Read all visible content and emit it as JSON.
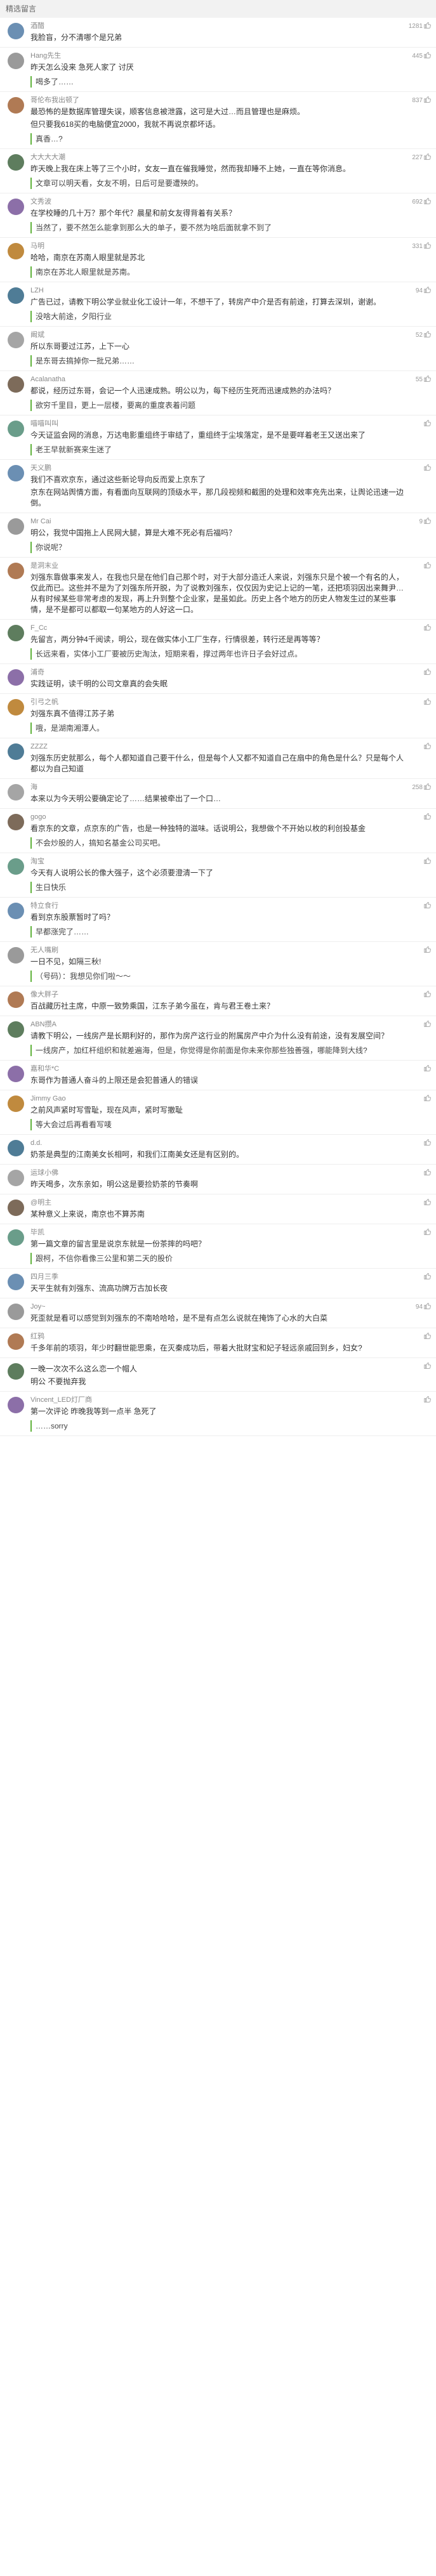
{
  "header": {
    "title": "精选留言"
  },
  "comments": [
    {
      "name": "酒醋",
      "date": "",
      "likes": "1281",
      "text": "我脸盲，分不清哪个是兄弟",
      "reply": ""
    },
    {
      "name": "Hang先生",
      "date": "",
      "likes": "445",
      "text": "昨天怎么没来 急死人家了 讨厌",
      "reply": "喝多了……"
    },
    {
      "name": "哥伦布我出顿了",
      "date": "",
      "likes": "837",
      "text": "最恐怖的是数据库管理失误，顺客信息被泄露，这可是大过…而且管理也是麻烦。",
      "text2": "但只要我618买的电脑便宜2000，我就不再说京都坏话。",
      "reply": "真香…?"
    },
    {
      "name": "大大大大潮",
      "date": "",
      "likes": "227",
      "text": "昨天晚上我在床上等了三个小时，女友一直在催我睡觉，然而我却睡不上她，一直在等你消息。",
      "reply": "文章可以明天看，女友不明，日后可是要遭殃的。"
    },
    {
      "name": "文秀波",
      "date": "",
      "likes": "692",
      "text": "在学校睡的几十万？那个年代？晨星和前女友得背着有关系？",
      "reply": "当然了，要不然怎么能拿到那么大的单子，要不然为啥后面就拿不到了"
    },
    {
      "name": "马明",
      "date": "",
      "likes": "331",
      "text": "哈哈，南京在苏南人眼里就是苏北",
      "reply": "南京在苏北人眼里就是苏南。"
    },
    {
      "name": "LZH",
      "date": "",
      "likes": "94",
      "text": "广告已过，请教下明公学业就业化工设计一年，不想干了，转房产中介是否有前途，打算去深圳，谢谢。",
      "reply": "没啥大前途，夕阳行业"
    },
    {
      "name": "阚斌",
      "date": "",
      "likes": "52",
      "text": "所以东哥要过江苏，上下一心",
      "reply": "是东哥去搞掉你一批兄弟……"
    },
    {
      "name": "Acalanatha",
      "date": "",
      "likes": "55",
      "text": "都说，经历过东哥，会记一个人迅速成熟。明公以为，每下经历生死而迅速成熟的办法吗？",
      "reply": "欲穷千里目，更上一层楼，要离的重度表着问题"
    },
    {
      "name": "喵喵叫叫",
      "date": "",
      "likes": "",
      "text": "今天证监会网的消息，万达电影重组终于审结了，重组终于尘埃落定，是不是要咩着老王又送出来了",
      "reply": "老王早就新赛来生迷了"
    },
    {
      "name": "天义鹏",
      "date": "",
      "likes": "",
      "text": "我们不喜欢京东，通过这些新论导向反而爱上京东了",
      "text2": "京东在网站舆情方面，有看面向互联网的顶级水平，那几段视频和截图的处理和效率充先出来，让舆论迅速一边倒。",
      "reply": ""
    },
    {
      "name": "Mr Cai",
      "date": "",
      "likes": "9",
      "text": "明公，我觉中国拖上人民网大腿，算是大难不死必有后福吗？",
      "reply": "你说呢？"
    },
    {
      "name": "是洞末业",
      "date": "",
      "likes": "",
      "text": "刘强东靠做事来发人，在我也只是在他们自己那个时，对于大部分造迁人来说，刘强东只是个被一个有名的人，仅此而已。这些并不是为了刘强东所开脱，为了说教刘强东，仅仅因为史记上记的一笔，还把项羽因出来舞尹…从有时候某些非常考虑的发现，再上升到整个企业家，是虽如此。历史上各个地方的历史人物发生过的某些事情，是不是都可以都取一句某地方的人好这一口。",
      "reply": ""
    },
    {
      "name": "F_Cc",
      "date": "",
      "likes": "",
      "text": "先留言，两分钟4千阅读，明公，现在做实体小工厂生存，行情很差，转行还是再等等？",
      "reply": "长远来看，实体小工厂要被历史淘汰，短期来看，撑过两年也许日子会好过点。"
    },
    {
      "name": "浦奇",
      "date": "",
      "likes": "",
      "text": "实践证明，读千明的公司文章真的会失眠",
      "reply": ""
    },
    {
      "name": "引弓之帆",
      "date": "",
      "likes": "",
      "text": "刘强东真不值得江苏子弟",
      "reply": "哦，是湖南湘潭人。"
    },
    {
      "name": "ZZZZ",
      "date": "",
      "likes": "",
      "text": "刘强东历史就那么，每个人都知道自己要干什么，但是每个人又都不知道自己在扇中的角色是什么？只是每个人都以为自己知道",
      "reply": ""
    },
    {
      "name": "海",
      "date": "",
      "likes": "258",
      "text": "本来以为今天明公要确定论了……结果被牵出了一个口…",
      "reply": ""
    },
    {
      "name": "gogo",
      "date": "",
      "likes": "",
      "text": "看京东的文章，点京东的广告，也是一种独特的滋味。话说明公，我想做个不开始以枚的利创投基金",
      "reply": "不会炒股的人，搞知名基金公司买吧。"
    },
    {
      "name": "淘宝",
      "date": "",
      "likes": "",
      "text": "今天有人说明公长的像大强子，这个必须要澄清一下了",
      "reply": "生日快乐"
    },
    {
      "name": "特立食行",
      "date": "",
      "likes": "",
      "text": "看到京东股票暂时了吗？",
      "reply": "早都涨完了……"
    },
    {
      "name": "无人嘴刷",
      "date": "",
      "likes": "",
      "text": "一日不见，如隔三秋!",
      "reply": "（号码）：我想见你们啦～～"
    },
    {
      "name": "像大胖子",
      "date": "",
      "likes": "",
      "text": "百战藏历社主席，中原一致势乘国，江东子弟今虽在，肯与君王卷土来？",
      "reply": ""
    },
    {
      "name": "ABN攒A",
      "date": "",
      "likes": "",
      "text": "请教下明公，一线房产是长期利好的，那作为房产这行业的附属房产中介为什么没有前途，没有发展空间？",
      "reply": "一线房产，加红杆组织和就差遍海，但是，你觉得是你前面是你未来你那些独善强，哪能降到大线?"
    },
    {
      "name": "嘉和华*C",
      "date": "",
      "likes": "",
      "text": "东哥作为普通人奋斗的上限还是会犯普通人的错误",
      "reply": ""
    },
    {
      "name": "Jimmy Gao",
      "date": "",
      "likes": "",
      "text": "之前风声紧时写雪耻，现在风声，紧时写撤耻",
      "reply": "等大会过后再看看写唛"
    },
    {
      "name": "d.d.",
      "date": "",
      "likes": "",
      "text": "奶茶是典型的江南美女长相呵，和我们江南美女还是有区别的。",
      "reply": ""
    },
    {
      "name": "运球小佛",
      "date": "",
      "likes": "",
      "text": "昨天喝多，次东亲如，明公这是要捡奶茶的节奏啊",
      "reply": ""
    },
    {
      "name": "@明主",
      "date": "",
      "likes": "",
      "text": "某种意义上来说，南京也不算苏南",
      "reply": ""
    },
    {
      "name": "毕凯",
      "date": "",
      "likes": "",
      "text": "第一篇文章的留言里是说京东就是一份茶摔的吗吧？",
      "reply": "跟柯，不信你看像三公里和第二天的股价"
    },
    {
      "name": "四月三季",
      "date": "",
      "likes": "",
      "text": "天平生就有刘强东、流高功牌万古加长夜",
      "reply": ""
    },
    {
      "name": "Joy~",
      "date": "",
      "likes": "94",
      "text": "死歪就是看可以感觉到刘强东的不南哈哈哈，是不是有点怎么说就在掩饰了心水的大白菜",
      "reply": ""
    },
    {
      "name": "红鸦",
      "date": "",
      "likes": "",
      "text": "千多年前的项羽，年少时翻世能思乘，在灭秦成功后，带着大批财宝和妃子轻远亲戚回到乡，妇女?",
      "reply": ""
    },
    {
      "name": "",
      "date": "",
      "likes": "",
      "text": "一晚一次次不么这么恋一个帽人",
      "text2": "明公 不要抛弃我",
      "reply": ""
    },
    {
      "name": "Vincent_LED灯厂商",
      "date": "",
      "likes": "",
      "text": "第一次评论 昨晚我等到一点半 急死了",
      "reply": "……sorry"
    }
  ]
}
